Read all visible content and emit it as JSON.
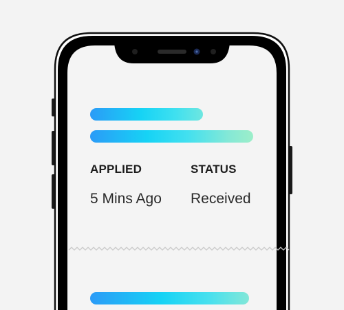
{
  "card": {
    "applied": {
      "label": "APPLIED",
      "value": "5 Mins Ago"
    },
    "status": {
      "label": "STATUS",
      "value": "Received"
    }
  },
  "colors": {
    "background": "#f3f3f3",
    "screen": "#f4f4f4",
    "phone_frame": "#000000",
    "gradient_start": "#2b9bf7",
    "gradient_mid": "#16d3f5",
    "gradient_end": "#9deec9"
  }
}
